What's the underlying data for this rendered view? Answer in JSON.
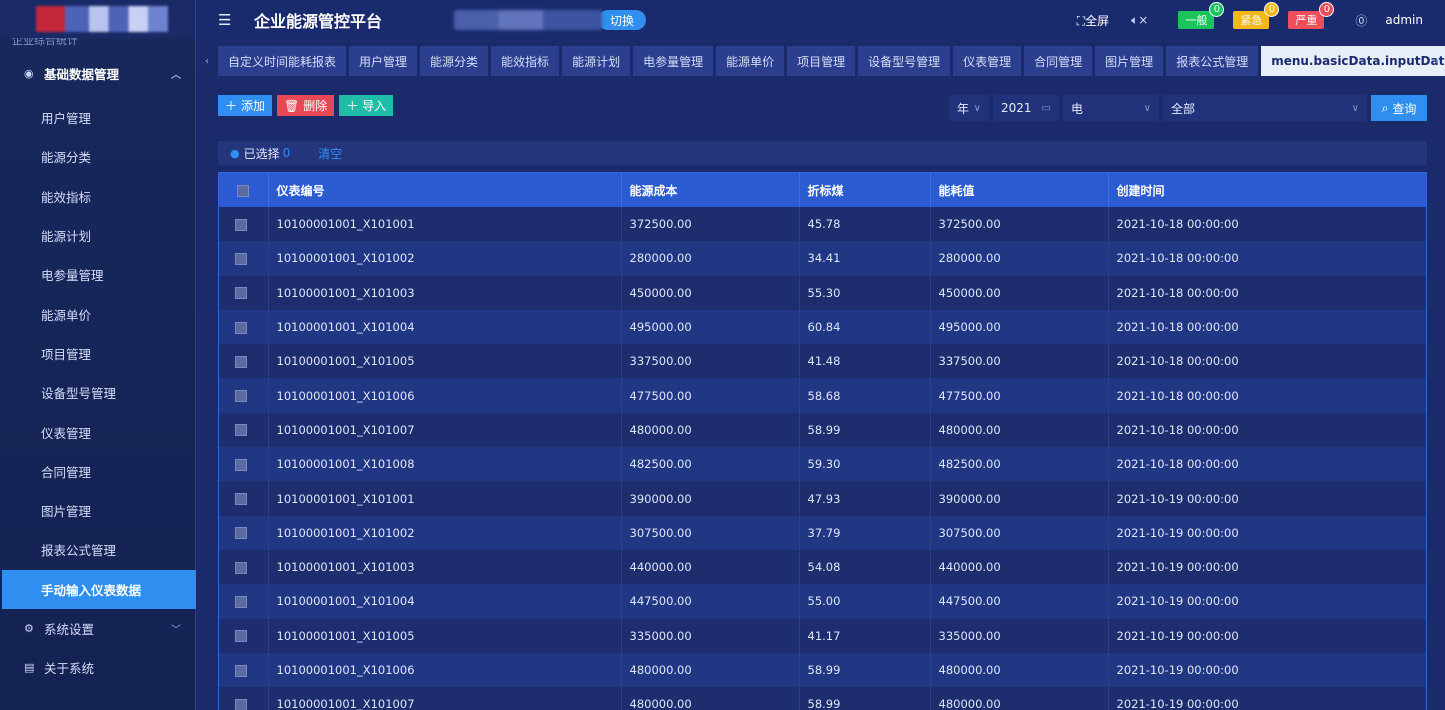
{
  "header": {
    "title": "企业能源管控平台",
    "switch_label": "切换",
    "fullscreen_label": "全屏",
    "alarms": [
      {
        "label": "一般",
        "count": "0",
        "color": "#1bc45b"
      },
      {
        "label": "紧急",
        "count": "0",
        "color": "#f3b81a"
      },
      {
        "label": "严重",
        "count": "0",
        "color": "#ee4e5a"
      }
    ],
    "user": "admin"
  },
  "sidebar": {
    "cut_item": "企业综合统计",
    "group": "基础数据管理",
    "items": [
      "用户管理",
      "能源分类",
      "能效指标",
      "能源计划",
      "电参量管理",
      "能源单价",
      "项目管理",
      "设备型号管理",
      "仪表管理",
      "合同管理",
      "图片管理",
      "报表公式管理",
      "手动输入仪表数据"
    ],
    "active_index": 12,
    "bottom": [
      {
        "label": "系统设置"
      },
      {
        "label": "关于系统"
      }
    ]
  },
  "tabs": [
    "自定义时间能耗报表",
    "用户管理",
    "能源分类",
    "能效指标",
    "能源计划",
    "电参量管理",
    "能源单价",
    "项目管理",
    "设备型号管理",
    "仪表管理",
    "合同管理",
    "图片管理",
    "报表公式管理",
    "menu.basicData.inputData"
  ],
  "toolbar": {
    "add": "添加",
    "delete": "删除",
    "import": "导入"
  },
  "filters": {
    "period": "年",
    "year": "2021",
    "energy": "电",
    "scope": "全部",
    "query": "查询"
  },
  "selection": {
    "label": "已选择",
    "count": "0",
    "clear": "清空"
  },
  "table": {
    "columns": [
      "仪表编号",
      "能源成本",
      "折标煤",
      "能耗值",
      "创建时间"
    ],
    "rows": [
      [
        "10100001001_X101001",
        "372500.00",
        "45.78",
        "372500.00",
        "2021-10-18 00:00:00"
      ],
      [
        "10100001001_X101002",
        "280000.00",
        "34.41",
        "280000.00",
        "2021-10-18 00:00:00"
      ],
      [
        "10100001001_X101003",
        "450000.00",
        "55.30",
        "450000.00",
        "2021-10-18 00:00:00"
      ],
      [
        "10100001001_X101004",
        "495000.00",
        "60.84",
        "495000.00",
        "2021-10-18 00:00:00"
      ],
      [
        "10100001001_X101005",
        "337500.00",
        "41.48",
        "337500.00",
        "2021-10-18 00:00:00"
      ],
      [
        "10100001001_X101006",
        "477500.00",
        "58.68",
        "477500.00",
        "2021-10-18 00:00:00"
      ],
      [
        "10100001001_X101007",
        "480000.00",
        "58.99",
        "480000.00",
        "2021-10-18 00:00:00"
      ],
      [
        "10100001001_X101008",
        "482500.00",
        "59.30",
        "482500.00",
        "2021-10-18 00:00:00"
      ],
      [
        "10100001001_X101001",
        "390000.00",
        "47.93",
        "390000.00",
        "2021-10-19 00:00:00"
      ],
      [
        "10100001001_X101002",
        "307500.00",
        "37.79",
        "307500.00",
        "2021-10-19 00:00:00"
      ],
      [
        "10100001001_X101003",
        "440000.00",
        "54.08",
        "440000.00",
        "2021-10-19 00:00:00"
      ],
      [
        "10100001001_X101004",
        "447500.00",
        "55.00",
        "447500.00",
        "2021-10-19 00:00:00"
      ],
      [
        "10100001001_X101005",
        "335000.00",
        "41.17",
        "335000.00",
        "2021-10-19 00:00:00"
      ],
      [
        "10100001001_X101006",
        "480000.00",
        "58.99",
        "480000.00",
        "2021-10-19 00:00:00"
      ],
      [
        "10100001001_X101007",
        "480000.00",
        "58.99",
        "480000.00",
        "2021-10-19 00:00:00"
      ]
    ]
  }
}
